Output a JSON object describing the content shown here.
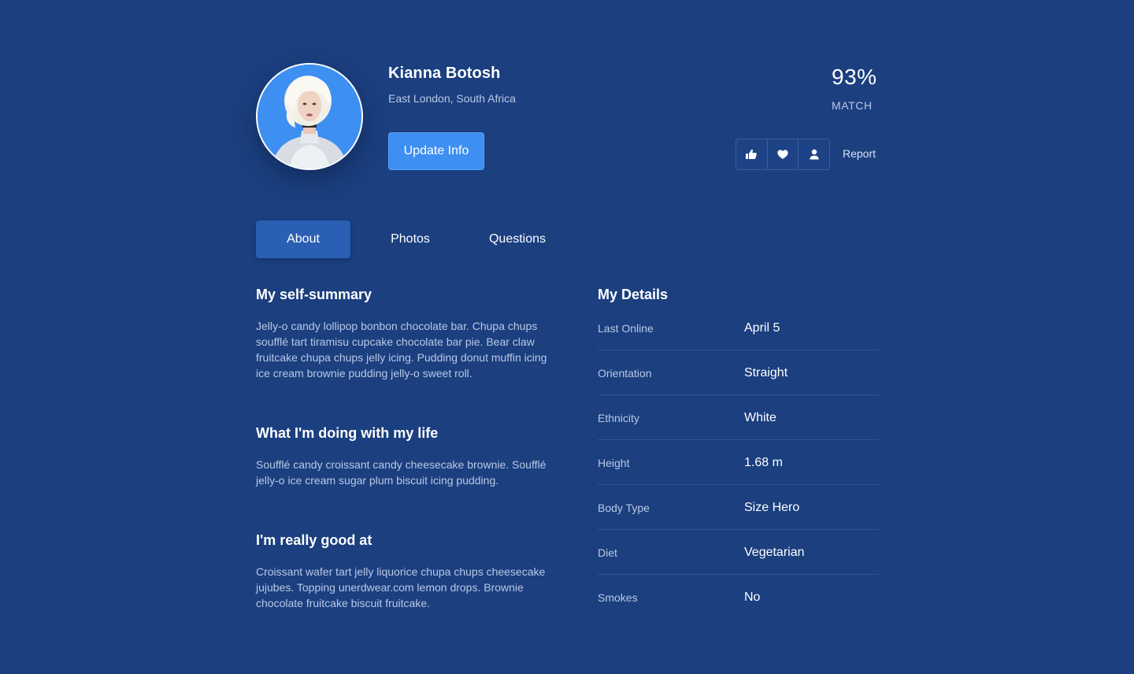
{
  "profile": {
    "name": "Kianna Botosh",
    "location": "East London, South Africa",
    "update_button": "Update Info"
  },
  "match": {
    "percent": "93%",
    "label": "MATCH"
  },
  "actions": {
    "icons": [
      "thumbs-up-icon",
      "heart-icon",
      "user-icon"
    ],
    "report_label": "Report"
  },
  "tabs": [
    {
      "label": "About",
      "active": true
    },
    {
      "label": "Photos",
      "active": false
    },
    {
      "label": "Questions",
      "active": false
    }
  ],
  "sections": [
    {
      "title": "My self-summary",
      "text": "Jelly-o candy lollipop bonbon chocolate bar. Chupa chups soufflé tart tiramisu cupcake chocolate bar pie. Bear claw fruitcake chupa chups jelly icing. Pudding donut muffin icing ice cream brownie pudding jelly-o sweet roll."
    },
    {
      "title": "What I'm doing with my life",
      "text": "Soufflé candy croissant candy cheesecake brownie. Soufflé jelly-o ice cream sugar plum biscuit icing pudding."
    },
    {
      "title": "I'm really good at",
      "text": "Croissant wafer tart jelly liquorice chupa chups cheesecake jujubes. Topping unerdwear.com lemon drops. Brownie chocolate fruitcake biscuit fruitcake."
    }
  ],
  "details": {
    "title": "My Details",
    "rows": [
      {
        "label": "Last Online",
        "value": "April 5"
      },
      {
        "label": "Orientation",
        "value": "Straight"
      },
      {
        "label": "Ethnicity",
        "value": "White"
      },
      {
        "label": "Height",
        "value": "1.68 m"
      },
      {
        "label": "Body Type",
        "value": "Size Hero"
      },
      {
        "label": "Diet",
        "value": "Vegetarian"
      },
      {
        "label": "Smokes",
        "value": "No"
      }
    ]
  },
  "colors": {
    "background": "#1b3f7f",
    "accent": "#3d8ff2",
    "active_tab": "#2a5fb4",
    "muted_text": "#b9c9e6"
  }
}
